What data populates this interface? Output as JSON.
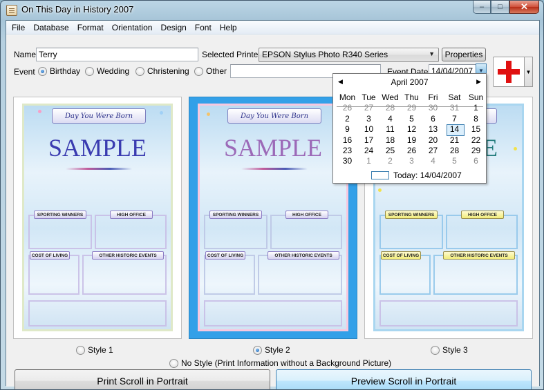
{
  "window": {
    "title": "On This Day in History 2007"
  },
  "caption": {
    "minimize": "–",
    "maximize": "□",
    "close": "✕"
  },
  "menu": [
    "File",
    "Database",
    "Format",
    "Orientation",
    "Design",
    "Font",
    "Help"
  ],
  "form": {
    "name_label": "Name",
    "name_value": "Terry",
    "printer_label": "Selected Printer",
    "printer_value": "EPSON Stylus Photo R340 Series",
    "properties_label": "Properties",
    "event_label": "Event",
    "events": [
      {
        "label": "Birthday",
        "checked": true
      },
      {
        "label": "Wedding",
        "checked": false
      },
      {
        "label": "Christening",
        "checked": false
      },
      {
        "label": "Other",
        "checked": false
      }
    ],
    "other_value": "",
    "event_date_label": "Event Date",
    "event_date_value": "14/04/2007"
  },
  "poster": {
    "banner": "Day You Were Born",
    "sample": "SAMPLE",
    "sections": [
      "SPORTING WINNERS",
      "HIGH OFFICE",
      "COST OF LIVING",
      "OTHER HISTORIC EVENTS"
    ]
  },
  "styles": [
    {
      "label": "Style 1",
      "checked": false
    },
    {
      "label": "Style 2",
      "checked": true
    },
    {
      "label": "Style 3",
      "checked": false
    }
  ],
  "no_style_label": "No Style (Print Information without a Background Picture)",
  "buttons": {
    "print": "Print Scroll in Portrait",
    "preview": "Preview Scroll in Portrait"
  },
  "calendar": {
    "month": "April 2007",
    "prev": "◀",
    "next": "▶",
    "weekdays": [
      "Mon",
      "Tue",
      "Wed",
      "Thu",
      "Fri",
      "Sat",
      "Sun"
    ],
    "weeks": [
      [
        "26",
        "27",
        "28",
        "29",
        "30",
        "31",
        "1"
      ],
      [
        "2",
        "3",
        "4",
        "5",
        "6",
        "7",
        "8"
      ],
      [
        "9",
        "10",
        "11",
        "12",
        "13",
        "14",
        "15"
      ],
      [
        "16",
        "17",
        "18",
        "19",
        "20",
        "21",
        "22"
      ],
      [
        "23",
        "24",
        "25",
        "26",
        "27",
        "28",
        "29"
      ],
      [
        "30",
        "1",
        "2",
        "3",
        "4",
        "5",
        "6"
      ]
    ],
    "selected_day": "14",
    "today_text": "Today: 14/04/2007"
  },
  "colors": {
    "selected_pane": "#33a0e8",
    "flag_red": "#e01010",
    "sample_style1": "#3a3bb0",
    "sample_style2": "#9c6ab8",
    "sample_style3": "#207a7a"
  },
  "icons": {
    "app": "app-scroll-icon",
    "flag": "red-cross-flag-icon",
    "dropdown": "chevron-down-icon",
    "calendar_prev": "triangle-left-icon",
    "calendar_next": "triangle-right-icon"
  }
}
